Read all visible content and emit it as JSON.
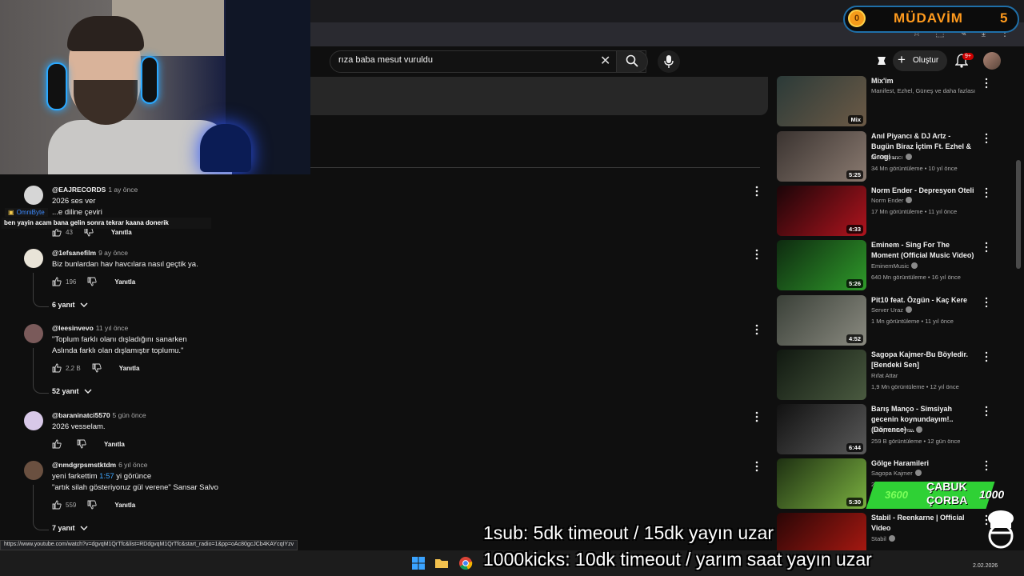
{
  "header": {
    "search_query": "rıza baba mesut vuruldu",
    "create_label": "Oluştur",
    "notifications_badge": "9+"
  },
  "badge": {
    "coin": "0",
    "label": "MÜDAVİM",
    "count": "5"
  },
  "chat": {
    "username": "OmniByte",
    "message": "ben yayin acam bana gelin sonra tekrar kaana donerik"
  },
  "comments": [
    {
      "user": "@EAJRECORDS",
      "time": "1 ay önce",
      "lines": [
        "2026 ses ver",
        "...e diline çeviri"
      ],
      "likes": "43",
      "reply_label": "Yanıtla",
      "avatar_color": "#d6d6d6"
    },
    {
      "user": "@1efsanefilm",
      "time": "9 ay önce",
      "lines": [
        "Biz bunlardan hav havcılara nasıl geçtik ya."
      ],
      "likes": "196",
      "reply_label": "Yanıtla",
      "replies": "6 yanıt",
      "avatar_color": "#e9e4d8"
    },
    {
      "user": "@leesinvevo",
      "time": "11 yıl önce",
      "lines": [
        "\"Toplum farklı olanı dışladığını sanarken",
        "Aslında farklı olan dışlamıştır toplumu.\""
      ],
      "likes": "2,2 B",
      "reply_label": "Yanıtla",
      "replies": "52 yanıt",
      "avatar_color": "#7a5a5a"
    },
    {
      "user": "@baraninatci5570",
      "time": "5 gün önce",
      "lines": [
        "2026 vesselam."
      ],
      "likes": "",
      "reply_label": "Yanıtla",
      "avatar_color": "#d8c8e8"
    },
    {
      "user": "@nmdgrpsmstktdm",
      "time": "6 yıl önce",
      "lines": [
        "yeni farkettim",
        "\"artık silah gösteriyoruz gül verene\"  Sansar Salvo"
      ],
      "timestamp_link": "1:57",
      "after_link": " yi görünce",
      "likes": "559",
      "reply_label": "Yanıtla",
      "replies": "7 yanıt",
      "avatar_color": "#6a5040"
    }
  ],
  "recommendations": [
    {
      "title": "Mix'im",
      "channel": "Manifest, Ezhel, Güneş ve daha fazlası",
      "meta": "",
      "badge": "Mix",
      "verified": false,
      "thumb_colors": [
        "#2b3a38",
        "#6c5a46"
      ]
    },
    {
      "title": "Anıl Piyancı & DJ Artz - Bugün Biraz İçtim Ft. Ezhel & Grogi ...",
      "channel": "Anıl Piyancı",
      "meta": "34 Mn görüntüleme • 10 yıl önce",
      "badge": "5:25",
      "verified": true,
      "thumb_colors": [
        "#3a3330",
        "#8a7a70"
      ]
    },
    {
      "title": "Norm Ender - Depresyon Oteli",
      "channel": "Norm Ender",
      "meta": "17 Mn görüntüleme • 11 yıl önce",
      "badge": "4:33",
      "verified": true,
      "thumb_colors": [
        "#1a0508",
        "#b0141e"
      ]
    },
    {
      "title": "Eminem - Sing For The Moment (Official Music Video)",
      "channel": "EminemMusic",
      "meta": "640 Mn görüntüleme • 16 yıl önce",
      "badge": "5:26",
      "verified": true,
      "thumb_colors": [
        "#0e2a10",
        "#2f9a2a"
      ]
    },
    {
      "title": "Pit10 feat. Özgün - Kaç Kere",
      "channel": "Server Uraz",
      "meta": "1 Mn görüntüleme • 11 yıl önce",
      "badge": "4:52",
      "verified": true,
      "thumb_colors": [
        "#3a4038",
        "#8a8a80"
      ]
    },
    {
      "title": "Sagopa Kajmer-Bu Böyledir. [Bendeki Sen]",
      "channel": "Rıfat Attar",
      "meta": "1,9 Mn görüntüleme • 12 yıl önce",
      "badge": "",
      "verified": false,
      "thumb_colors": [
        "#101810",
        "#4a5a40"
      ]
    },
    {
      "title": "Barış Manço - Simsiyah gecenin koynundayım!.. (Dönence) ...",
      "channel": "Barış Yurtseven",
      "meta": "259 B görüntüleme • 12 gün önce",
      "badge": "6:44",
      "verified": true,
      "thumb_colors": [
        "#111111",
        "#5a5a5a"
      ]
    },
    {
      "title": "Gölge Haramileri",
      "channel": "Sagopa Kajmer",
      "meta": "28 Mn görüntüleme",
      "badge": "5:30",
      "verified": true,
      "thumb_colors": [
        "#1e3012",
        "#7ab040"
      ]
    },
    {
      "title": "Stabil - Reenkarne | Official Video",
      "channel": "Stabil",
      "meta": "",
      "badge": "",
      "verified": true,
      "thumb_colors": [
        "#2a0606",
        "#b01a12"
      ]
    }
  ],
  "status_url": "https://www.youtube.com/watch?v=dgvqM1QrTfc&list=RDdgvqM1QrTfc&start_radio=1&pp=oAc80gcJCb4KAYcqIYzv",
  "overlay": {
    "line1": "1sub: 5dk timeout / 15dk yayın uzar",
    "line2": "1000kicks: 10dk timeout / yarım saat yayın uzar",
    "corba_line1": "ÇABUK",
    "corba_line2": "ÇORBA",
    "corba_num1": "3600",
    "corba_num2": "1000"
  },
  "taskbar": {
    "date": "2.02.2026"
  },
  "colors": {
    "background": "#0f0f0f",
    "badge_orange": "#ff9a1d",
    "chat_blue": "#3d8bff",
    "corba_green": "#2fd135"
  }
}
